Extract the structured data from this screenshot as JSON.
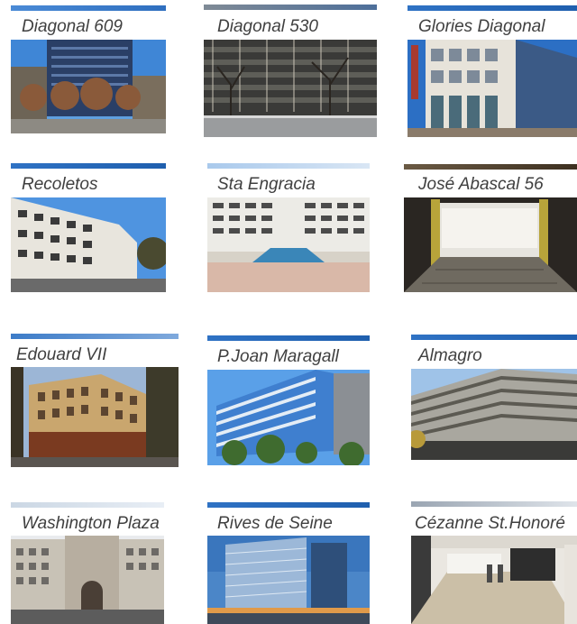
{
  "properties": [
    {
      "name": "Diagonal 609"
    },
    {
      "name": "Diagonal 530"
    },
    {
      "name": "Glories Diagonal"
    },
    {
      "name": "Recoletos"
    },
    {
      "name": "Sta Engracia"
    },
    {
      "name": "José Abascal 56"
    },
    {
      "name": "Edouard VII"
    },
    {
      "name": "P.Joan Maragall"
    },
    {
      "name": "Almagro"
    },
    {
      "name": "Washington Plaza"
    },
    {
      "name": "Rives de Seine"
    },
    {
      "name": "Cézanne St.Honoré"
    }
  ],
  "colors": {
    "accent_bar": "#2f72c4",
    "label_text": "#404040",
    "background": "#ffffff"
  }
}
